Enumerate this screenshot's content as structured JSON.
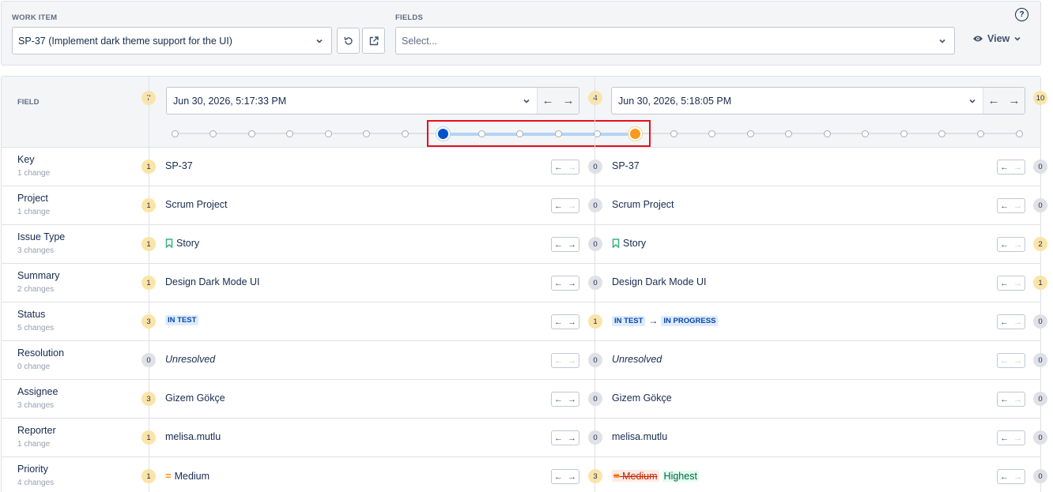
{
  "top": {
    "work_item_label": "WORK ITEM",
    "work_item_value": "SP-37 (Implement dark theme support for the UI)",
    "fields_label": "FIELDS",
    "fields_placeholder": "Select...",
    "view_label": "View",
    "help_glyph": "?"
  },
  "compare": {
    "field_header": "FIELD",
    "left": {
      "badge": "7",
      "date": "Jun 30, 2026, 5:17:33 PM"
    },
    "middle_badge": "4",
    "right": {
      "badge": "10",
      "date": "Jun 30, 2026, 5:18:05 PM"
    },
    "timeline": {
      "total_points": 23,
      "start_index": 7,
      "end_index": 12
    }
  },
  "rows": [
    {
      "name": "Key",
      "count": "1 change",
      "left_badge": "1",
      "left_value": "SP-37",
      "mid_badge": "0",
      "right_value": "SP-37",
      "right_badge": "0"
    },
    {
      "name": "Project",
      "count": "1 change",
      "left_badge": "1",
      "left_value": "Scrum Project",
      "mid_badge": "0",
      "right_value": "Scrum Project",
      "right_badge": "0"
    },
    {
      "name": "Issue Type",
      "count": "3 changes",
      "left_badge": "1",
      "left_value": "Story",
      "mid_badge": "0",
      "right_value": "Story",
      "right_badge": "2"
    },
    {
      "name": "Summary",
      "count": "2 changes",
      "left_badge": "1",
      "left_value": "Design Dark Mode UI",
      "mid_badge": "0",
      "right_value": "Design Dark Mode UI",
      "right_badge": "1"
    },
    {
      "name": "Status",
      "count": "5 changes",
      "left_badge": "3",
      "left_value": "IN TEST",
      "mid_badge": "1",
      "right_from": "IN TEST",
      "right_to": "IN PROGRESS",
      "right_badge": "0"
    },
    {
      "name": "Resolution",
      "count": "0 change",
      "left_badge": "0",
      "left_value": "Unresolved",
      "mid_badge": "0",
      "right_value": "Unresolved",
      "right_badge": "0"
    },
    {
      "name": "Assignee",
      "count": "3 changes",
      "left_badge": "3",
      "left_value": "Gizem Gökçe",
      "mid_badge": "0",
      "right_value": "Gizem Gökçe",
      "right_badge": "0"
    },
    {
      "name": "Reporter",
      "count": "1 change",
      "left_badge": "1",
      "left_value": "melisa.mutlu",
      "mid_badge": "0",
      "right_value": "melisa.mutlu",
      "right_badge": "0"
    },
    {
      "name": "Priority",
      "count": "4 changes",
      "left_badge": "1",
      "left_value": "Medium",
      "mid_badge": "3",
      "right_old": "Medium",
      "right_new": "Highest",
      "right_badge": "0"
    }
  ],
  "colors": {
    "start_dot": "#0052cc",
    "end_dot": "#f79a1e",
    "highlight": "#e5101c",
    "badge_yellow": "#fbe4a8",
    "badge_gray": "#dfe1e6"
  },
  "icons": [
    "refresh-icon",
    "open-external-icon",
    "eye-icon",
    "chevron-down-icon",
    "arrow-left-icon",
    "arrow-right-icon",
    "story-bookmark-icon",
    "priority-medium-icon",
    "help-icon"
  ]
}
